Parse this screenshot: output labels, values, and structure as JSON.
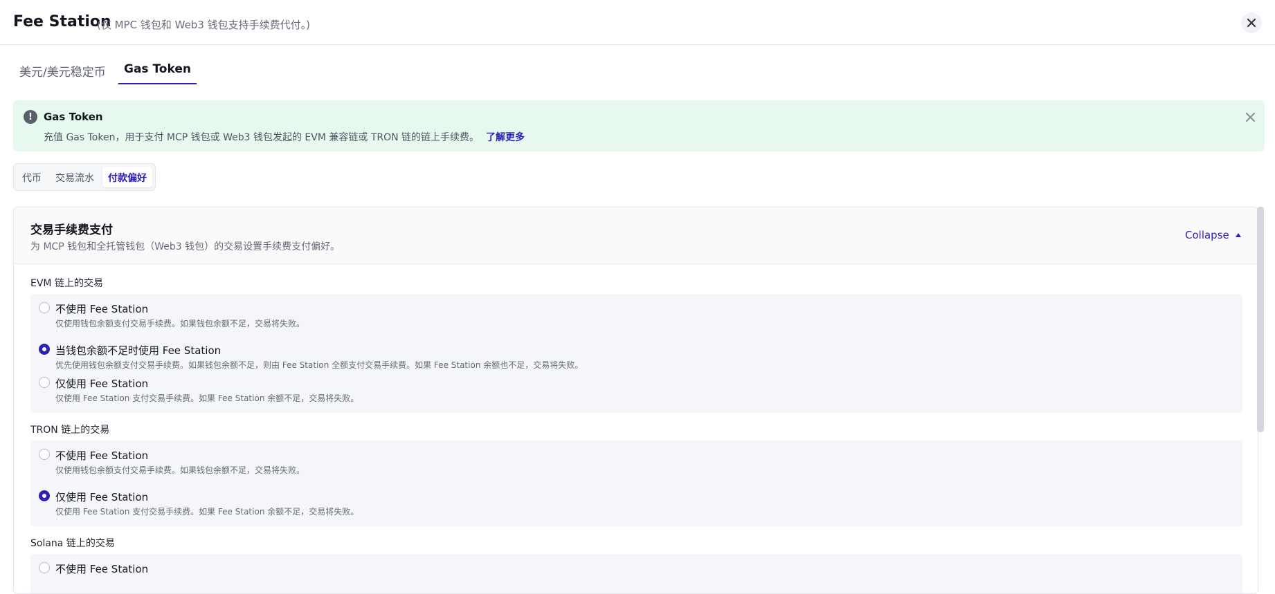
{
  "header": {
    "title": "Fee Station",
    "subtitle": "(仅 MPC 钱包和 Web3 钱包支持手续费代付。)"
  },
  "tabs": [
    {
      "label": "美元/美元稳定币",
      "active": false
    },
    {
      "label": "Gas Token",
      "active": true
    }
  ],
  "banner": {
    "title": "Gas Token",
    "text": "充值 Gas Token，用于支付 MCP 钱包或 Web3 钱包发起的 EVM 兼容链或 TRON 链的链上手续费。",
    "link": "了解更多",
    "icon": "lightbulb-icon"
  },
  "subtabs": [
    {
      "label": "代币",
      "active": false
    },
    {
      "label": "交易流水",
      "active": false
    },
    {
      "label": "付款偏好",
      "active": true
    }
  ],
  "panel": {
    "title": "交易手续费支付",
    "description": "为 MCP 钱包和全托管钱包（Web3 钱包）的交易设置手续费支付偏好。",
    "collapse_label": "Collapse",
    "sections": [
      {
        "label": "EVM 链上的交易",
        "options": [
          {
            "label": "不使用 Fee Station",
            "help": "仅使用钱包余额支付交易手续费。如果钱包余额不足，交易将失败。",
            "checked": false
          },
          {
            "label": "当钱包余额不足时使用 Fee Station",
            "help": "优先使用钱包余额支付交易手续费。如果钱包余额不足，则由 Fee Station 全额支付交易手续费。如果 Fee Station 余额也不足，交易将失败。",
            "checked": true
          },
          {
            "label": "仅使用 Fee Station",
            "help": "仅使用 Fee Station 支付交易手续费。如果 Fee Station 余额不足，交易将失败。",
            "checked": false
          }
        ]
      },
      {
        "label": "TRON 链上的交易",
        "options": [
          {
            "label": "不使用 Fee Station",
            "help": "仅使用钱包余额支付交易手续费。如果钱包余额不足，交易将失败。",
            "checked": false
          },
          {
            "label": "仅使用 Fee Station",
            "help": "仅使用 Fee Station 支付交易手续费。如果 Fee Station 余额不足，交易将失败。",
            "checked": true
          }
        ]
      },
      {
        "label": "Solana 链上的交易",
        "options": [
          {
            "label": "不使用 Fee Station",
            "checked": false
          }
        ]
      }
    ]
  },
  "colors": {
    "accent": "#2d1fb8",
    "banner_bg": "#e7f8ee"
  }
}
